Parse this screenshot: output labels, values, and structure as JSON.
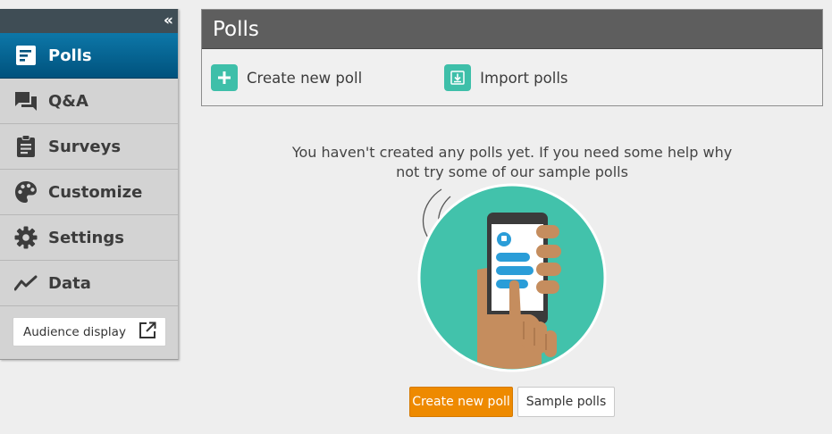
{
  "sidebar": {
    "collapse_glyph": "«",
    "items": [
      {
        "label": "Polls",
        "icon": "poll-icon",
        "active": true
      },
      {
        "label": "Q&A",
        "icon": "chat-icon",
        "active": false
      },
      {
        "label": "Surveys",
        "icon": "clipboard-icon",
        "active": false
      },
      {
        "label": "Customize",
        "icon": "palette-icon",
        "active": false
      },
      {
        "label": "Settings",
        "icon": "gear-icon",
        "active": false
      },
      {
        "label": "Data",
        "icon": "trend-icon",
        "active": false
      }
    ],
    "audience_display": {
      "label": "Audience display",
      "icon": "external-link-icon"
    }
  },
  "panel": {
    "title": "Polls",
    "actions": [
      {
        "label": "Create new poll",
        "icon": "plus-icon"
      },
      {
        "label": "Import polls",
        "icon": "import-icon"
      }
    ]
  },
  "empty_state": {
    "message": "You haven't created any polls yet. If you need some help why not try some of our sample polls",
    "illustration": "phone-in-hand-illustration",
    "primary_button": "Create new poll",
    "secondary_button": "Sample polls"
  },
  "colors": {
    "active_nav": "#00527d",
    "accent_teal": "#3ebfa9",
    "primary_orange": "#ee8a00",
    "panel_header": "#5e5e5e"
  }
}
